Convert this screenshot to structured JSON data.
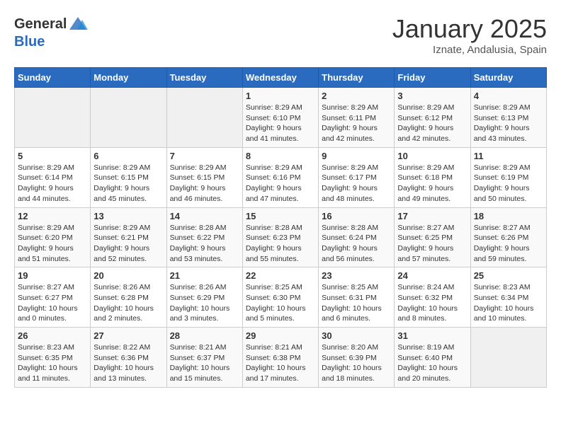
{
  "header": {
    "logo_general": "General",
    "logo_blue": "Blue",
    "month": "January 2025",
    "location": "Iznate, Andalusia, Spain"
  },
  "days_of_week": [
    "Sunday",
    "Monday",
    "Tuesday",
    "Wednesday",
    "Thursday",
    "Friday",
    "Saturday"
  ],
  "weeks": [
    [
      {
        "day": "",
        "info": ""
      },
      {
        "day": "",
        "info": ""
      },
      {
        "day": "",
        "info": ""
      },
      {
        "day": "1",
        "info": "Sunrise: 8:29 AM\nSunset: 6:10 PM\nDaylight: 9 hours\nand 41 minutes."
      },
      {
        "day": "2",
        "info": "Sunrise: 8:29 AM\nSunset: 6:11 PM\nDaylight: 9 hours\nand 42 minutes."
      },
      {
        "day": "3",
        "info": "Sunrise: 8:29 AM\nSunset: 6:12 PM\nDaylight: 9 hours\nand 42 minutes."
      },
      {
        "day": "4",
        "info": "Sunrise: 8:29 AM\nSunset: 6:13 PM\nDaylight: 9 hours\nand 43 minutes."
      }
    ],
    [
      {
        "day": "5",
        "info": "Sunrise: 8:29 AM\nSunset: 6:14 PM\nDaylight: 9 hours\nand 44 minutes."
      },
      {
        "day": "6",
        "info": "Sunrise: 8:29 AM\nSunset: 6:15 PM\nDaylight: 9 hours\nand 45 minutes."
      },
      {
        "day": "7",
        "info": "Sunrise: 8:29 AM\nSunset: 6:15 PM\nDaylight: 9 hours\nand 46 minutes."
      },
      {
        "day": "8",
        "info": "Sunrise: 8:29 AM\nSunset: 6:16 PM\nDaylight: 9 hours\nand 47 minutes."
      },
      {
        "day": "9",
        "info": "Sunrise: 8:29 AM\nSunset: 6:17 PM\nDaylight: 9 hours\nand 48 minutes."
      },
      {
        "day": "10",
        "info": "Sunrise: 8:29 AM\nSunset: 6:18 PM\nDaylight: 9 hours\nand 49 minutes."
      },
      {
        "day": "11",
        "info": "Sunrise: 8:29 AM\nSunset: 6:19 PM\nDaylight: 9 hours\nand 50 minutes."
      }
    ],
    [
      {
        "day": "12",
        "info": "Sunrise: 8:29 AM\nSunset: 6:20 PM\nDaylight: 9 hours\nand 51 minutes."
      },
      {
        "day": "13",
        "info": "Sunrise: 8:29 AM\nSunset: 6:21 PM\nDaylight: 9 hours\nand 52 minutes."
      },
      {
        "day": "14",
        "info": "Sunrise: 8:28 AM\nSunset: 6:22 PM\nDaylight: 9 hours\nand 53 minutes."
      },
      {
        "day": "15",
        "info": "Sunrise: 8:28 AM\nSunset: 6:23 PM\nDaylight: 9 hours\nand 55 minutes."
      },
      {
        "day": "16",
        "info": "Sunrise: 8:28 AM\nSunset: 6:24 PM\nDaylight: 9 hours\nand 56 minutes."
      },
      {
        "day": "17",
        "info": "Sunrise: 8:27 AM\nSunset: 6:25 PM\nDaylight: 9 hours\nand 57 minutes."
      },
      {
        "day": "18",
        "info": "Sunrise: 8:27 AM\nSunset: 6:26 PM\nDaylight: 9 hours\nand 59 minutes."
      }
    ],
    [
      {
        "day": "19",
        "info": "Sunrise: 8:27 AM\nSunset: 6:27 PM\nDaylight: 10 hours\nand 0 minutes."
      },
      {
        "day": "20",
        "info": "Sunrise: 8:26 AM\nSunset: 6:28 PM\nDaylight: 10 hours\nand 2 minutes."
      },
      {
        "day": "21",
        "info": "Sunrise: 8:26 AM\nSunset: 6:29 PM\nDaylight: 10 hours\nand 3 minutes."
      },
      {
        "day": "22",
        "info": "Sunrise: 8:25 AM\nSunset: 6:30 PM\nDaylight: 10 hours\nand 5 minutes."
      },
      {
        "day": "23",
        "info": "Sunrise: 8:25 AM\nSunset: 6:31 PM\nDaylight: 10 hours\nand 6 minutes."
      },
      {
        "day": "24",
        "info": "Sunrise: 8:24 AM\nSunset: 6:32 PM\nDaylight: 10 hours\nand 8 minutes."
      },
      {
        "day": "25",
        "info": "Sunrise: 8:23 AM\nSunset: 6:34 PM\nDaylight: 10 hours\nand 10 minutes."
      }
    ],
    [
      {
        "day": "26",
        "info": "Sunrise: 8:23 AM\nSunset: 6:35 PM\nDaylight: 10 hours\nand 11 minutes."
      },
      {
        "day": "27",
        "info": "Sunrise: 8:22 AM\nSunset: 6:36 PM\nDaylight: 10 hours\nand 13 minutes."
      },
      {
        "day": "28",
        "info": "Sunrise: 8:21 AM\nSunset: 6:37 PM\nDaylight: 10 hours\nand 15 minutes."
      },
      {
        "day": "29",
        "info": "Sunrise: 8:21 AM\nSunset: 6:38 PM\nDaylight: 10 hours\nand 17 minutes."
      },
      {
        "day": "30",
        "info": "Sunrise: 8:20 AM\nSunset: 6:39 PM\nDaylight: 10 hours\nand 18 minutes."
      },
      {
        "day": "31",
        "info": "Sunrise: 8:19 AM\nSunset: 6:40 PM\nDaylight: 10 hours\nand 20 minutes."
      },
      {
        "day": "",
        "info": ""
      }
    ]
  ]
}
